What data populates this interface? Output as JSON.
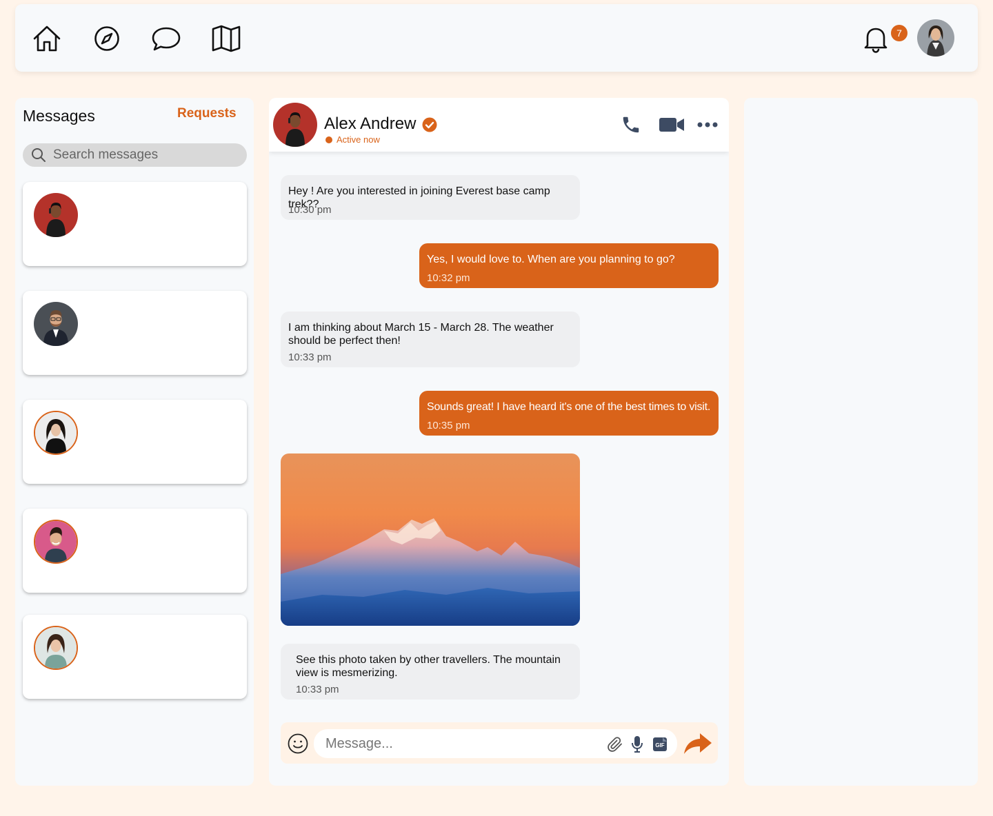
{
  "nav": {
    "notification_count": "7"
  },
  "sidebar": {
    "title": "Messages",
    "requests_label": "Requests",
    "search_placeholder": "Search messages"
  },
  "chat": {
    "contact_name": "Alex Andrew",
    "status": "Active now",
    "messages": [
      {
        "direction": "in",
        "text": "Hey ! Are you interested in joining Everest base camp trek??",
        "time": "10:30 pm"
      },
      {
        "direction": "out",
        "text": "Yes, I would love to. When are you planning to go?",
        "time": "10:32 pm"
      },
      {
        "direction": "in",
        "text": "I am thinking about March 15 - March 28. The weather should be perfect then!",
        "time": "10:33 pm"
      },
      {
        "direction": "out",
        "text": "Sounds great! I have heard it's one of the best times to visit.",
        "time": "10:35 pm"
      },
      {
        "direction": "in",
        "text": "See this photo taken by other travellers. The mountain view is mesmerizing.",
        "time": "10:33 pm"
      }
    ],
    "composer_placeholder": "Message..."
  },
  "colors": {
    "accent": "#d9631a",
    "background": "#fff4ea",
    "panel": "#f7f9fb",
    "bubble_in": "#eeeff1"
  }
}
